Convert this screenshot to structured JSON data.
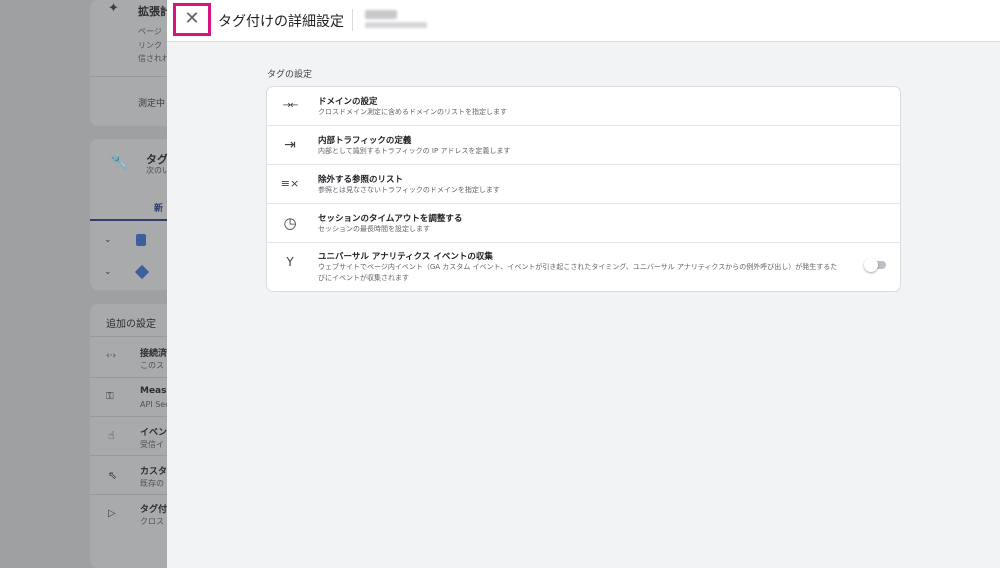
{
  "background": {
    "card1": {
      "icon": "sparkle-icon",
      "title": "拡張計",
      "lines": [
        "ページ",
        "リンク",
        "信されれ"
      ],
      "footer": "測定中"
    },
    "card2": {
      "icon": "wrench-icon",
      "title": "タグ",
      "subtitle": "次のい",
      "tab": "新"
    },
    "card3": {
      "header": "追加の設定",
      "items": [
        {
          "icon": "code-arrows-icon",
          "title": "接続済",
          "sub": "このス"
        },
        {
          "icon": "key-icon",
          "title": "Measu",
          "sub": "API Sec"
        },
        {
          "icon": "touch-icon",
          "title": "イベン",
          "sub": "受信イ"
        },
        {
          "icon": "click-icon",
          "title": "カスタ",
          "sub": "既存の"
        },
        {
          "icon": "label-icon",
          "title": "タグ付",
          "sub": "クロス"
        }
      ]
    }
  },
  "panel": {
    "title": "タグ付けの詳細設定",
    "close_icon": "close-icon",
    "section_label": "タグの設定",
    "rows": [
      {
        "icon": "arrows-inward-icon",
        "glyph": "→←",
        "title": "ドメインの設定",
        "desc": "クロスドメイン測定に含めるドメインのリストを指定します"
      },
      {
        "icon": "login-icon",
        "glyph": "⇥",
        "title": "内部トラフィックの定義",
        "desc": "内部として識別するトラフィックの IP アドレスを定義します"
      },
      {
        "icon": "rule-icon",
        "glyph": "≡",
        "title": "除外する参照のリスト",
        "desc": "参照とは見なさないトラフィックのドメインを指定します"
      },
      {
        "icon": "clock-icon",
        "glyph": "◷",
        "title": "セッションのタイムアウトを調整する",
        "desc": "セッションの最長時間を設定します"
      },
      {
        "icon": "merge-icon",
        "glyph": "Y",
        "title": "ユニバーサル アナリティクス イベントの収集",
        "desc": "ウェブサイトでページ内イベント（GA カスタム イベント、イベントが引き起こされたタイミング、ユニバーサル アナリティクスからの例外呼び出し）が発生するたびにイベントが収集されます"
      }
    ],
    "toggle_on": false
  },
  "colors": {
    "highlight": "#d6157f",
    "panel_bg": "#f1f3f4",
    "overlay": "#9fa0a2"
  }
}
